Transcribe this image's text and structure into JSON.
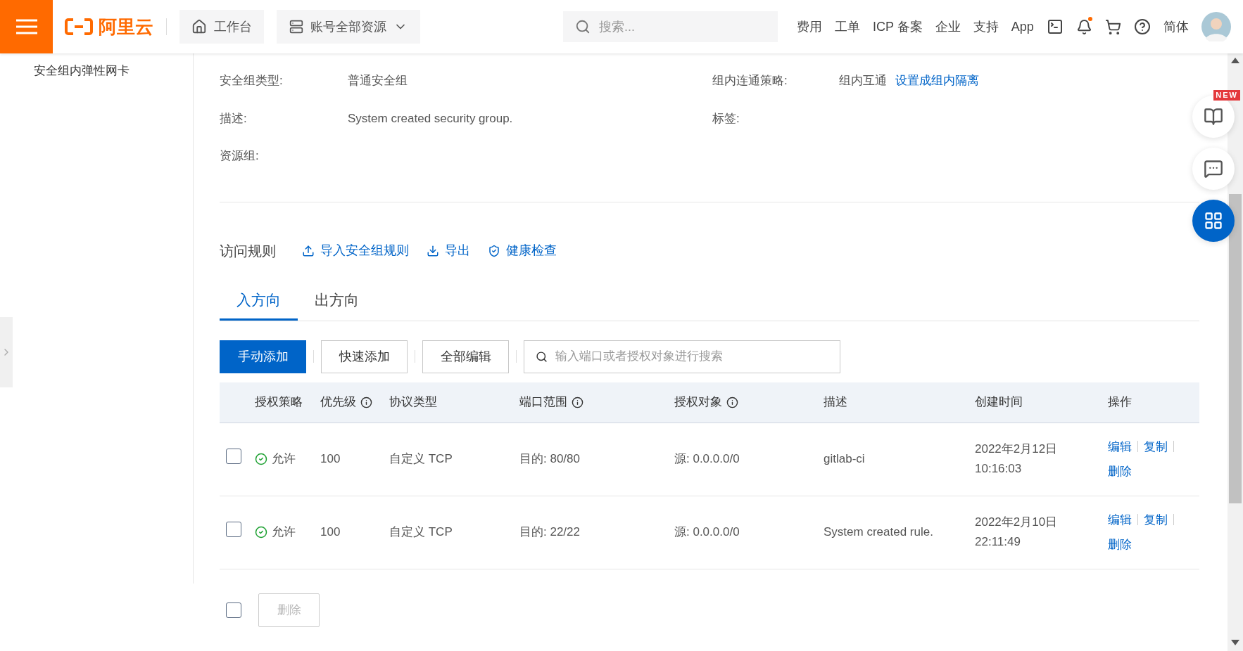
{
  "topbar": {
    "logo": "阿里云",
    "workbench": "工作台",
    "resources": "账号全部资源",
    "search": {
      "placeholder": "搜索..."
    },
    "links": [
      "费用",
      "工单",
      "ICP 备案",
      "企业",
      "支持",
      "App"
    ],
    "notification_dot": true,
    "language": "简体"
  },
  "sidebar": {
    "items": [
      {
        "label": "安全组内弹性网卡",
        "selected": false
      }
    ]
  },
  "details": [
    {
      "label": "安全组类型:",
      "value": "普通安全组"
    },
    {
      "label": "组内连通策略:",
      "value": "组内互通",
      "link": "设置成组内隔离"
    },
    {
      "label": "描述:",
      "value": "System created security group."
    },
    {
      "label": "标签:"
    },
    {
      "label": "资源组:"
    }
  ],
  "rules": {
    "title": "访问规则",
    "actions": [
      {
        "kind": "import",
        "label": "导入安全组规则"
      },
      {
        "kind": "export",
        "label": "导出"
      },
      {
        "kind": "health",
        "label": "健康检查"
      }
    ]
  },
  "tabs": [
    {
      "label": "入方向",
      "selected": true
    },
    {
      "label": "出方向",
      "selected": false
    }
  ],
  "toolbar": {
    "buttons": [
      {
        "label": "手动添加",
        "primary": true
      },
      {
        "label": "快速添加",
        "primary": false
      },
      {
        "label": "全部编辑",
        "primary": false
      }
    ],
    "search": {
      "placeholder": "输入端口或者授权对象进行搜索"
    }
  },
  "table": {
    "columns": [
      {
        "label": "授权策略",
        "info": false
      },
      {
        "label": "优先级",
        "info": true
      },
      {
        "label": "协议类型",
        "info": false
      },
      {
        "label": "端口范围",
        "info": true
      },
      {
        "label": "授权对象",
        "info": true
      },
      {
        "label": "描述",
        "info": false
      },
      {
        "label": "创建时间",
        "info": false
      },
      {
        "label": "操作",
        "info": false
      }
    ],
    "rows": [
      {
        "checked": false,
        "policy": "允许",
        "priority": "100",
        "protocol": "自定义 TCP",
        "ports": "目的: 80/80",
        "source": "源: 0.0.0.0/0",
        "description": "gitlab-ci",
        "created": [
          "2022年2月12日",
          "10:16:03"
        ],
        "actions": [
          "编辑",
          "复制",
          "删除"
        ]
      },
      {
        "checked": false,
        "policy": "允许",
        "priority": "100",
        "protocol": "自定义 TCP",
        "ports": "目的: 22/22",
        "source": "源: 0.0.0.0/0",
        "description": "System created rule.",
        "created": [
          "2022年2月10日",
          "22:11:49"
        ],
        "actions": [
          "编辑",
          "复制",
          "删除"
        ]
      }
    ]
  },
  "footer": {
    "checked": false,
    "delete": {
      "label": "删除",
      "disabled": true
    }
  },
  "float_buttons": [
    {
      "kind": "guide",
      "badge": "NEW"
    },
    {
      "kind": "feedback"
    },
    {
      "kind": "apps"
    }
  ]
}
